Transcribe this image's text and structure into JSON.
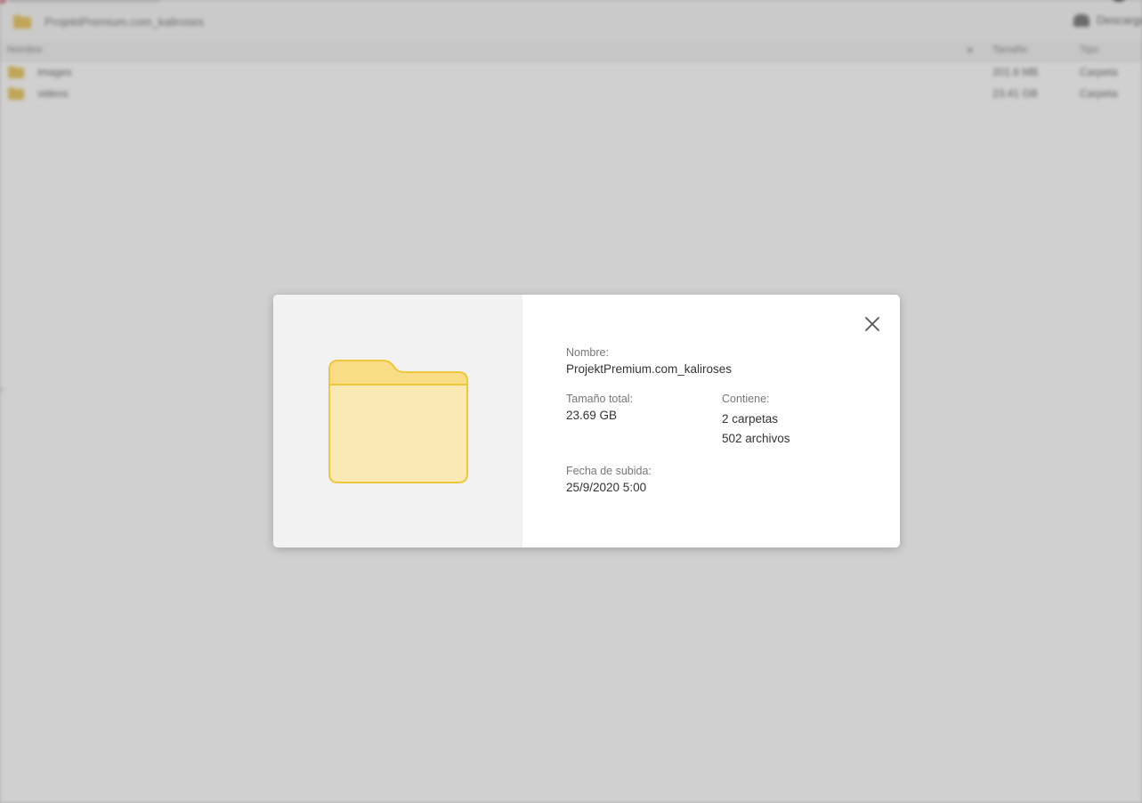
{
  "background": {
    "path_title": "ProjektPremium.com_kaliroses",
    "download_label": "Descargar",
    "columns": {
      "name": "Nombre",
      "size": "Tamaño",
      "type": "Tipo"
    },
    "rows": [
      {
        "name": "images",
        "size": "201.6 MB",
        "type": "Carpeta"
      },
      {
        "name": "videos",
        "size": "23.41 GB",
        "type": "Carpeta"
      }
    ]
  },
  "modal": {
    "name_label": "Nombre:",
    "name_value": "ProjektPremium.com_kaliroses",
    "size_label": "Tamaño total:",
    "size_value": "23.69 GB",
    "contains_label": "Contiene:",
    "contains_folders": "2 carpetas",
    "contains_files": "502 archivos",
    "uploaded_label": "Fecha de subida:",
    "uploaded_value": "25/9/2020 5:00"
  },
  "icons": {
    "folder": "folder-icon",
    "close": "close-icon",
    "download": "cloud-download-icon"
  },
  "colors": {
    "folder_fill": "#fbe9b5",
    "folder_tab": "#f8dd86",
    "folder_stroke": "#f0c63a",
    "overlay": "#9e9e9e",
    "preview_panel": "#f2f2f2"
  }
}
